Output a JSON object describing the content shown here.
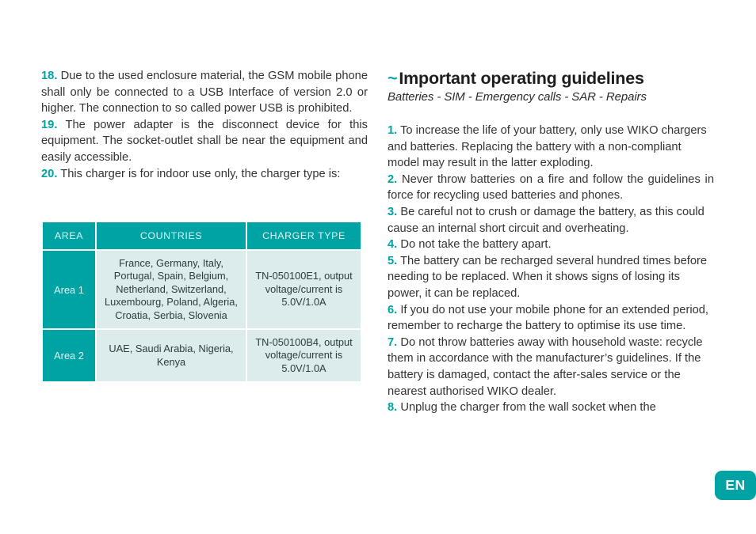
{
  "document": {
    "language_badge": "EN"
  },
  "left_column": {
    "paragraphs": [
      {
        "number": "18.",
        "text": "Due to the used enclosure material, the GSM mobile phone shall only be connected to a USB Interface of version 2.0 or higher. The connection to so called power USB is prohibited."
      },
      {
        "number": "19.",
        "text": "The power adapter is the disconnect device for this equipment. The socket-outlet shall be near the equipment and easily accessible."
      },
      {
        "number": "20.",
        "text": "This charger is for indoor use only, the charger type is:"
      }
    ]
  },
  "table": {
    "headers": [
      "AREA",
      "COUNTRIES",
      "CHARGER TYPE"
    ],
    "rows": [
      {
        "area": "Area 1",
        "countries": "France, Germany, Italy, Portugal, Spain, Belgium, Netherland, Switzerland, Luxembourg, Poland, Algeria, Croatia, Serbia, Slovenia",
        "charger_type": "TN-050100E1, output voltage/current is 5.0V/1.0A"
      },
      {
        "area": "Area 2",
        "countries": "UAE, Saudi Arabia, Nigeria, Kenya",
        "charger_type": "TN-050100B4, output voltage/current is 5.0V/1.0A"
      }
    ]
  },
  "right_column": {
    "heading_marker": "~",
    "heading": "Important operating guidelines",
    "subheading": "Batteries - SIM - Emergency calls - SAR - Repairs",
    "paragraphs": [
      {
        "number": "1.",
        "text": "To increase the life of your battery, only use WIKO chargers and batteries. Replacing the battery with a non-compliant model may result in the latter exploding."
      },
      {
        "number": "2.",
        "text": "Never throw batteries on a fire and follow the guidelines in force for recycling used batteries and phones."
      },
      {
        "number": "3.",
        "text": "Be careful not to crush or damage the battery, as this could cause an internal short circuit and overheating."
      },
      {
        "number": "4.",
        "text": "Do not take the battery apart."
      },
      {
        "number": "5.",
        "text": "The battery can be recharged several hundred times before needing to be replaced. When it shows signs of losing its power, it can be replaced."
      },
      {
        "number": "6.",
        "text": "If you do not use your mobile phone for an extended period, remember to recharge the battery to optimise its use time."
      },
      {
        "number": "7.",
        "text": "Do not throw batteries away with household waste: recycle them in accordance with the manufacturer’s guidelines. If the battery is damaged, contact the after-sales service or the nearest authorised WIKO dealer."
      },
      {
        "number": "8.",
        "text": "Unplug the charger from the wall socket when the"
      }
    ]
  },
  "colors": {
    "accent": "#00a3a3",
    "table_cell_bg": "#dcecec",
    "text": "#333333"
  }
}
